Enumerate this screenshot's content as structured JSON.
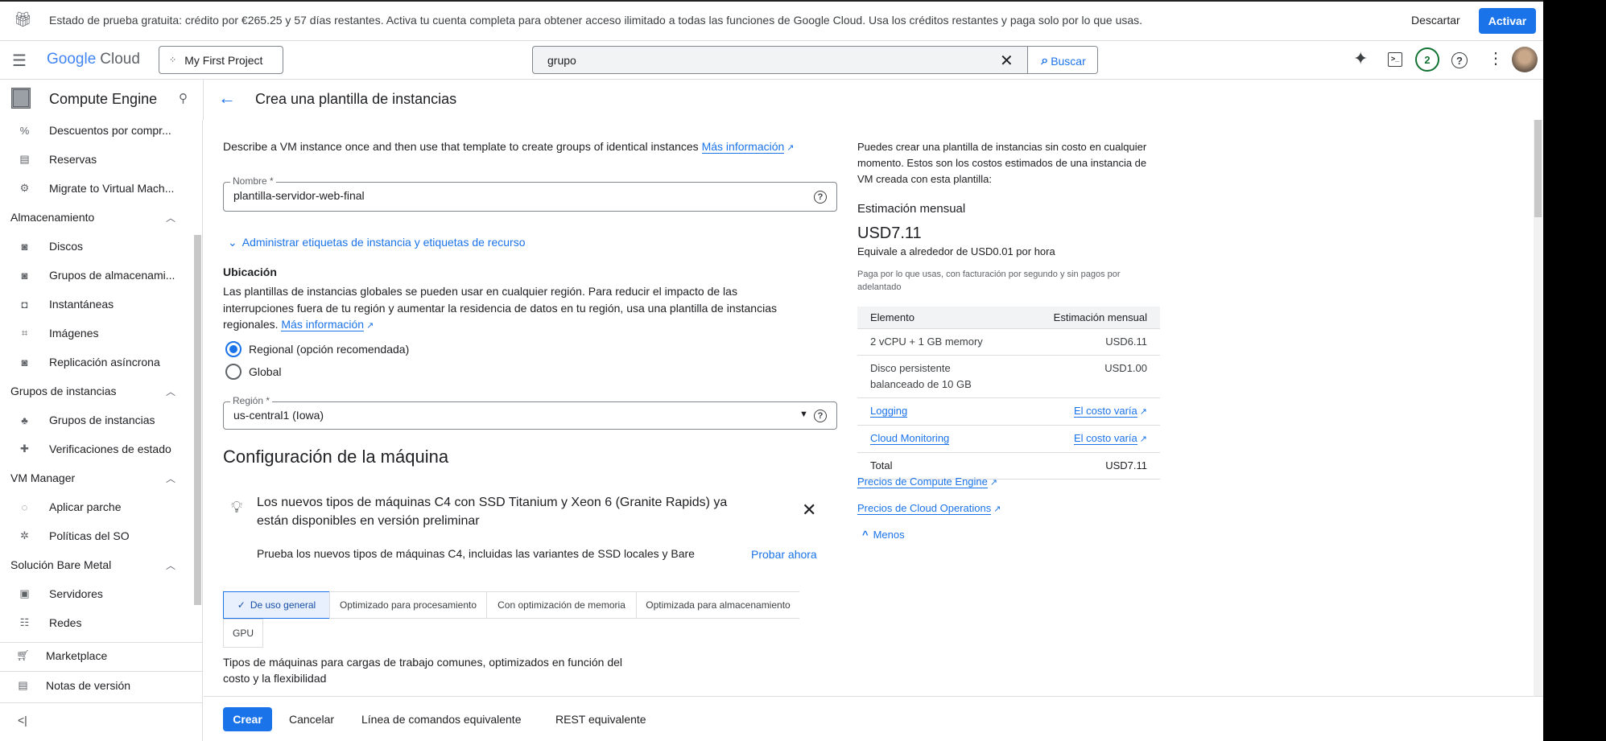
{
  "banner": {
    "text": "Estado de prueba gratuita: crédito por €265.25 y 57 días restantes. Activa tu cuenta completa para obtener acceso ilimitado a todas las funciones de Google Cloud. Usa los créditos restantes y paga solo por lo que usas.",
    "dismiss": "Descartar",
    "activate": "Activar"
  },
  "header": {
    "logo_google": "Google",
    "logo_cloud": "Cloud",
    "project": "My First Project",
    "search_value": "grupo",
    "search_button": "Buscar",
    "notifications": "2"
  },
  "sidebar": {
    "title": "Compute Engine",
    "items": [
      {
        "type": "item",
        "label": "Descuentos por compr...",
        "icon": "%"
      },
      {
        "type": "item",
        "label": "Reservas",
        "icon": "▤"
      },
      {
        "type": "item",
        "label": "Migrate to Virtual Mach...",
        "icon": "⚙"
      },
      {
        "type": "head",
        "label": "Almacenamiento"
      },
      {
        "type": "item",
        "label": "Discos",
        "icon": "◙"
      },
      {
        "type": "item",
        "label": "Grupos de almacenami...",
        "icon": "◙"
      },
      {
        "type": "item",
        "label": "Instantáneas",
        "icon": "◘"
      },
      {
        "type": "item",
        "label": "Imágenes",
        "icon": "⌗"
      },
      {
        "type": "item",
        "label": "Replicación asíncrona",
        "icon": "◙"
      },
      {
        "type": "head",
        "label": "Grupos de instancias"
      },
      {
        "type": "item",
        "label": "Grupos de instancias",
        "icon": "♣"
      },
      {
        "type": "item",
        "label": "Verificaciones de estado",
        "icon": "✚"
      },
      {
        "type": "head",
        "label": "VM Manager"
      },
      {
        "type": "item",
        "label": "Aplicar parche",
        "icon": "◌"
      },
      {
        "type": "item",
        "label": "Políticas del SO",
        "icon": "✲"
      },
      {
        "type": "head",
        "label": "Solución Bare Metal"
      },
      {
        "type": "item",
        "label": "Servidores",
        "icon": "▣"
      },
      {
        "type": "item",
        "label": "Redes",
        "icon": "☷"
      }
    ],
    "marketplace": "Marketplace",
    "release_notes": "Notas de versión"
  },
  "page": {
    "title": "Crea una plantilla de instancias",
    "description": "Describe a VM instance once and then use that template to create groups of identical instances",
    "more_info": "Más información",
    "name_label": "Nombre *",
    "name_value": "plantilla-servidor-web-final",
    "manage_labels": "Administrar etiquetas de instancia y etiquetas de recurso",
    "location_title": "Ubicación",
    "location_text": "Las plantillas de instancias globales se pueden usar en cualquier región. Para reducir el impacto de las interrupciones fuera de tu región y aumentar la residencia de datos en tu región, usa una plantilla de instancias regionales.",
    "location_more": "Más información",
    "radio_regional": "Regional (opción recomendada)",
    "radio_global": "Global",
    "selected_location": "Regional",
    "region_label": "Región *",
    "region_value": "us-central1 (Iowa)",
    "machine_title": "Configuración de la máquina",
    "promo_title": "Los nuevos tipos de máquinas C4 con SSD Titanium y Xeon 6 (Granite Rapids) ya están disponibles en versión preliminar",
    "promo_text": "Prueba los nuevos tipos de máquinas C4, incluidas las variantes de SSD locales y Bare",
    "promo_action": "Probar ahora",
    "tabs": [
      "De uso general",
      "Optimizado para procesamiento",
      "Con optimización de memoria",
      "Optimizada para almacenamiento",
      "GPU"
    ],
    "active_tab": "De uso general",
    "tab_description": "Tipos de máquinas para cargas de trabajo comunes, optimizados en función del costo y la flexibilidad"
  },
  "pricing": {
    "intro": "Puedes crear una plantilla de instancias sin costo en cualquier momento. Estos son los costos estimados de una instancia de VM creada con esta plantilla:",
    "title": "Estimación mensual",
    "total_big": "USD7.11",
    "hourly": "Equivale a alrededor de USD0.01 por hora",
    "note": "Paga por lo que usas, con facturación por segundo y sin pagos por adelantado",
    "col_item": "Elemento",
    "col_estimate": "Estimación mensual",
    "rows": [
      {
        "item": "2 vCPU + 1 GB memory",
        "cost": "USD6.11"
      },
      {
        "item": "Disco persistente balanceado de 10 GB",
        "cost": "USD1.00"
      },
      {
        "item": "Logging",
        "cost": "El costo varía"
      },
      {
        "item": "Cloud Monitoring",
        "cost": "El costo varía"
      },
      {
        "item": "Total",
        "cost": "USD7.11"
      }
    ],
    "link_ce": "Precios de Compute Engine",
    "link_co": "Precios de Cloud Operations",
    "less": "Menos"
  },
  "actions": {
    "create": "Crear",
    "cancel": "Cancelar",
    "cli": "Línea de comandos equivalente",
    "rest": "REST equivalente"
  }
}
